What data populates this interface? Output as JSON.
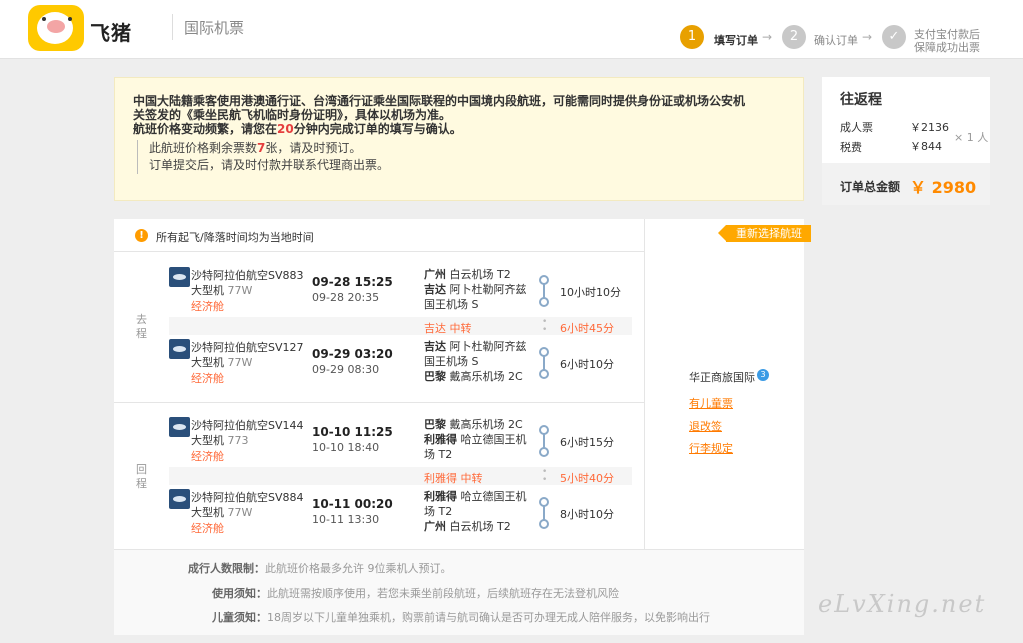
{
  "header": {
    "logo_text": "飞猪",
    "title": "国际机票",
    "steps": [
      {
        "num": "1",
        "label": "填写订单",
        "active": true
      },
      {
        "num": "2",
        "label": "确认订单",
        "active": false
      },
      {
        "num": "✓",
        "label_lines": [
          "支付宝付款后",
          "保障成功出票"
        ],
        "active": false
      }
    ]
  },
  "notice": {
    "line1": "中国大陆籍乘客使用港澳通行证、台湾通行证乘坐国际联程的中国境内段航班，可能需同时提供身份证或机场公安机",
    "line2": "关签发的《乘坐民航飞机临时身份证明》，具体以机场为准。",
    "line3_prefix": "航班价格变动频繁，请您在",
    "line3_minutes": "20",
    "line3_suffix": "分钟内完成订单的填写与确认。",
    "sub1_prefix": "此航班价格剩余票数",
    "sub1_count": "7",
    "sub1_suffix": "张，请及时预订。",
    "sub2": "订单提交后，请及时付款并联系代理商出票。"
  },
  "price": {
    "title": "往返程",
    "adult_label": "成人票",
    "adult_value": "￥2136",
    "multiplier": "× 1 人",
    "tax_label": "税费",
    "tax_value": "￥844",
    "total_label": "订单总金额",
    "total_value": "￥ 2980"
  },
  "flights": {
    "warning": "所有起飞/降落时间均为当地时间",
    "reselect": "重新选择航班",
    "outbound_label": "去程",
    "return_label": "回程",
    "segments": [
      {
        "airline": "沙特阿拉伯航空SV883",
        "size": "大型机",
        "type": "77W",
        "cabin": "经济舱",
        "dep": "09-28 15:25",
        "arr": "09-28 20:35",
        "from": "广州",
        "from_ap": "白云机场 T2",
        "to": "吉达",
        "to_ap": "阿卜杜勒阿齐兹国王机场 S",
        "duration": "10小时10分"
      },
      {
        "airline": "沙特阿拉伯航空SV127",
        "size": "大型机",
        "type": "77W",
        "cabin": "经济舱",
        "dep": "09-29 03:20",
        "arr": "09-29 08:30",
        "from": "吉达",
        "from_ap": "阿卜杜勒阿齐兹国王机场 S",
        "to": "巴黎",
        "to_ap": "戴高乐机场 2C",
        "duration": "6小时10分"
      },
      {
        "airline": "沙特阿拉伯航空SV144",
        "size": "大型机",
        "type": "773",
        "cabin": "经济舱",
        "dep": "10-10 11:25",
        "arr": "10-10 18:40",
        "from": "巴黎",
        "from_ap": "戴高乐机场 2C",
        "to": "利雅得",
        "to_ap": "哈立德国王机场 T2",
        "duration": "6小时15分"
      },
      {
        "airline": "沙特阿拉伯航空SV884",
        "size": "大型机",
        "type": "77W",
        "cabin": "经济舱",
        "dep": "10-11 00:20",
        "arr": "10-11 13:30",
        "from": "利雅得",
        "from_ap": "哈立德国王机场 T2",
        "to": "广州",
        "to_ap": "白云机场 T2",
        "duration": "8小时10分"
      }
    ],
    "transfers": [
      {
        "city": "吉达 中转",
        "duration": "6小时45分"
      },
      {
        "city": "利雅得 中转",
        "duration": "5小时40分"
      }
    ],
    "agent": {
      "name": "华正商旅国际",
      "badge": "3",
      "links": [
        "有儿童票",
        "退改签",
        "行李规定"
      ]
    },
    "rules": [
      {
        "label": "成行人数限制：",
        "text": "此航班价格最多允许 9位乘机人预订。"
      },
      {
        "label": "使用须知：",
        "text": "此航班需按顺序使用，若您未乘坐前段航班，后续航班存在无法登机风险"
      },
      {
        "label": "儿童须知：",
        "text": "18周岁以下儿童单独乘机，购票前请与航司确认是否可办理无成人陪伴服务，以免影响出行"
      }
    ]
  },
  "watermark": "eLvXing.net",
  "colors": {
    "accent": "#ff8a00",
    "active_step": "#e8a000",
    "inactive_step": "#c8c8c8",
    "link": "#ff7a00"
  }
}
